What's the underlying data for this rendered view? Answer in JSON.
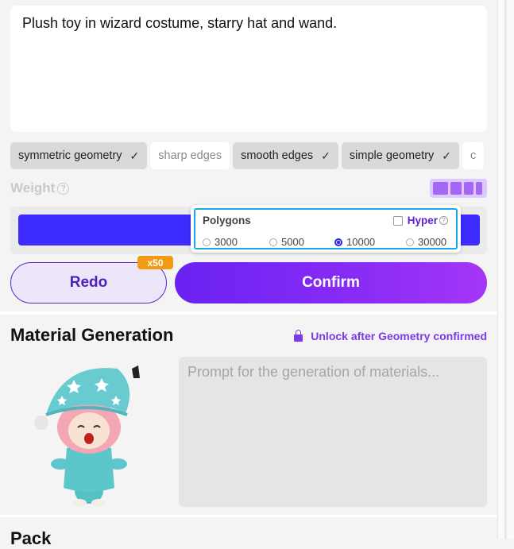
{
  "prompt": {
    "text": "Plush toy in wizard costume, starry hat and wand."
  },
  "tags": [
    {
      "label": "symmetric geometry",
      "selected": true
    },
    {
      "label": "sharp edges",
      "selected": false
    },
    {
      "label": "smooth edges",
      "selected": true
    },
    {
      "label": "simple geometry",
      "selected": true
    },
    {
      "label": "c",
      "selected": false
    }
  ],
  "weight": {
    "label": "Weight"
  },
  "polygons": {
    "title": "Polygons",
    "hyper_label": "Hyper",
    "options": [
      "3000",
      "5000",
      "10000",
      "30000"
    ],
    "selected": "10000"
  },
  "actions": {
    "redo_label": "Redo",
    "redo_badge": "x50",
    "confirm_label": "Confirm"
  },
  "material": {
    "title": "Material Generation",
    "unlock_text": "Unlock after Geometry confirmed",
    "placeholder": "Prompt for the generation of materials..."
  },
  "pack": {
    "title": "Pack"
  },
  "colors": {
    "accent": "#5a26c9",
    "confirm_gradient_start": "#6a22f2",
    "confirm_gradient_end": "#a436f6",
    "badge": "#f39b12",
    "selection_border": "#1aa8e8"
  }
}
